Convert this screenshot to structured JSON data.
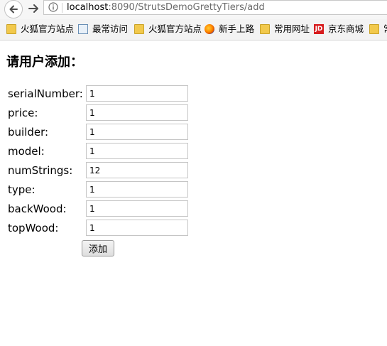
{
  "browser": {
    "url_host": "localhost",
    "url_rest": ":8090/StrutsDemoGrettyTiers/add"
  },
  "bookmarks": [
    {
      "label": "火狐官方站点",
      "icon": "folder-icon"
    },
    {
      "label": "最常访问",
      "icon": "most-visited-icon"
    },
    {
      "label": "火狐官方站点",
      "icon": "folder-icon"
    },
    {
      "label": "新手上路",
      "icon": "firefox-icon"
    },
    {
      "label": "常用网址",
      "icon": "folder-icon"
    },
    {
      "label": "京东商城",
      "icon": "jd-icon",
      "icon_text": "JD"
    },
    {
      "label": "常",
      "icon": "folder-icon"
    }
  ],
  "page": {
    "heading": "请用户添加：",
    "fields": [
      {
        "label": "serialNumber:",
        "value": "1"
      },
      {
        "label": "price:",
        "value": "1"
      },
      {
        "label": "builder:",
        "value": "1"
      },
      {
        "label": "model:",
        "value": "1"
      },
      {
        "label": "numStrings:",
        "value": "12"
      },
      {
        "label": "type:",
        "value": "1"
      },
      {
        "label": "backWood:",
        "value": "1"
      },
      {
        "label": "topWood:",
        "value": "1"
      }
    ],
    "submit_label": "添加"
  }
}
